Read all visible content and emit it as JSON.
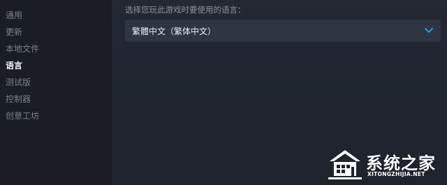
{
  "sidebar": {
    "items": [
      {
        "label": "通用",
        "active": false
      },
      {
        "label": "更新",
        "active": false
      },
      {
        "label": "本地文件",
        "active": false
      },
      {
        "label": "语言",
        "active": true
      },
      {
        "label": "测试版",
        "active": false
      },
      {
        "label": "控制器",
        "active": false
      },
      {
        "label": "创意工坊",
        "active": false
      }
    ]
  },
  "main": {
    "language_prompt": "选择您玩此游戏时要使用的语言：",
    "language_select": {
      "value": "繁體中文（繁体中文）",
      "icon": "chevron-down-icon"
    }
  },
  "watermark": {
    "brand_cn": "系统之家",
    "brand_en": "XITONGZHIJIA.NET"
  },
  "colors": {
    "sidebar_bg": "#1a1d23",
    "content_bg": "#232833",
    "select_bg": "#2f3541",
    "accent": "#1a9fff",
    "text_active": "#eef1f5",
    "text_muted": "#7b8088"
  }
}
